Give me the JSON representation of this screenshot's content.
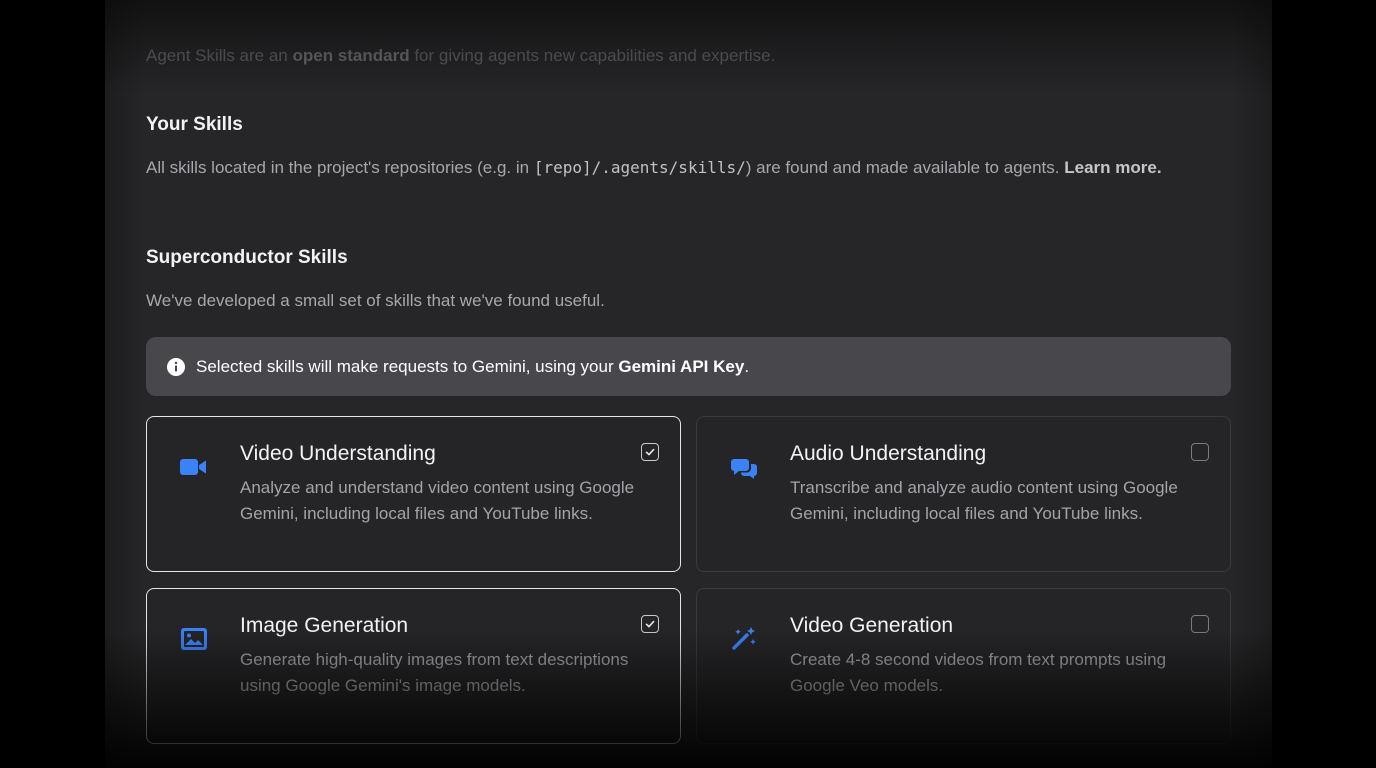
{
  "intro": {
    "prefix": "Agent Skills are an ",
    "bold": "open standard",
    "suffix": " for giving agents new capabilities and expertise."
  },
  "your_skills": {
    "heading": "Your Skills",
    "desc_prefix": "All skills located in the project's repositories (e.g. in ",
    "desc_path": "[repo]/.agents/skills/",
    "desc_suffix": ") are found and made available to agents. ",
    "learn_more": "Learn more."
  },
  "superconductor": {
    "heading": "Superconductor Skills",
    "desc": "We've developed a small set of skills that we've found useful."
  },
  "notice": {
    "prefix": "Selected skills will make requests to Gemini, using your ",
    "api_key": "Gemini API Key",
    "suffix": "."
  },
  "skills": [
    {
      "title": "Video Understanding",
      "description": "Analyze and understand video content using Google Gemini, including local files and YouTube links.",
      "checked": true,
      "icon": "video-camera-icon"
    },
    {
      "title": "Audio Understanding",
      "description": "Transcribe and analyze audio content using Google Gemini, including local files and YouTube links.",
      "checked": false,
      "icon": "chat-bubbles-icon"
    },
    {
      "title": "Image Generation",
      "description": "Generate high-quality images from text descriptions using Google Gemini's image models.",
      "checked": true,
      "icon": "image-icon"
    },
    {
      "title": "Video Generation",
      "description": "Create 4-8 second videos from text prompts using Google Veo models.",
      "checked": false,
      "icon": "magic-wand-icon"
    }
  ],
  "colors": {
    "accent": "#3b82f6",
    "panel": "#262628",
    "notice": "#48484c"
  }
}
